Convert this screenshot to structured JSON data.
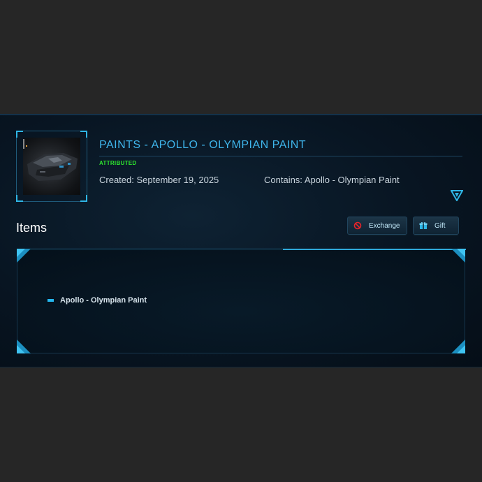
{
  "product": {
    "title": "PAINTS - APOLLO - OLYMPIAN PAINT",
    "status": "ATTRIBUTED",
    "created": "Created: September 19, 2025",
    "contains": "Contains: Apollo - Olympian Paint",
    "thumbnail_icon": "ship-paint-image"
  },
  "items_section": {
    "heading": "Items",
    "buttons": [
      {
        "label": "Exchange",
        "icon": "exchange-icon"
      },
      {
        "label": "Gift",
        "icon": "gift-icon"
      }
    ],
    "items": [
      {
        "label": "Apollo - Olympian Paint"
      }
    ]
  },
  "colors": {
    "accent": "#3fb6ec",
    "status": "#2ee62e",
    "background": "#262626",
    "panel": "#081522"
  }
}
